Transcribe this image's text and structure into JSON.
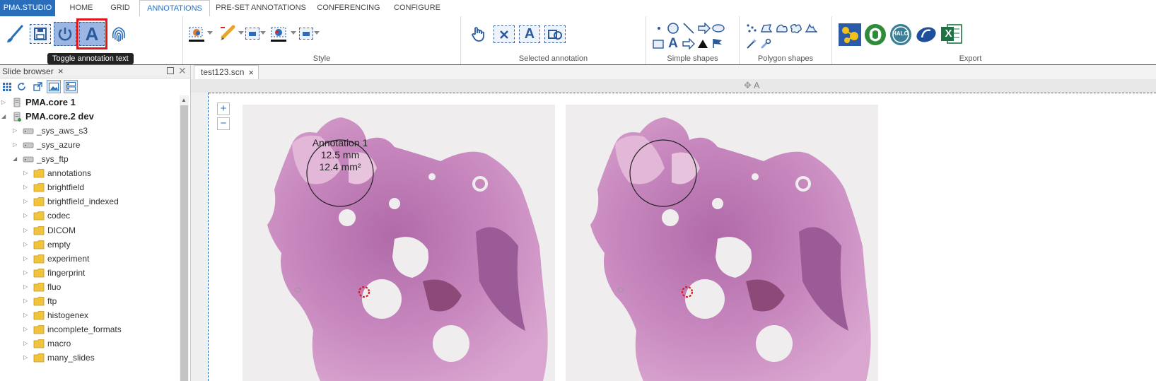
{
  "tabs": [
    {
      "label": "PMA.STUDIO",
      "kind": "brand"
    },
    {
      "label": "HOME",
      "kind": "normal"
    },
    {
      "label": "GRID",
      "kind": "normal"
    },
    {
      "label": "ANNOTATIONS",
      "kind": "active"
    },
    {
      "label": "PRE-SET ANNOTATIONS",
      "kind": "normal"
    },
    {
      "label": "CONFERENCING",
      "kind": "normal"
    },
    {
      "label": "CONFIGURE",
      "kind": "normal"
    }
  ],
  "ribbon": {
    "groups": {
      "style": "Style",
      "selected": "Selected annotation",
      "simple": "Simple shapes",
      "polygon": "Polygon shapes",
      "export": "Export"
    },
    "text_tool_glyph": "A",
    "tooltip": "Toggle annotation text",
    "highlighted_tool": "toggle-annotation-text",
    "export_labels": {
      "halo": "HALO",
      "excel": "X"
    }
  },
  "slide_browser": {
    "title": "Slide browser",
    "close": "×",
    "tree": [
      {
        "label": "PMA.core 1",
        "level": 0,
        "kind": "server",
        "expanded": false
      },
      {
        "label": "PMA.core.2 dev",
        "level": 0,
        "kind": "server-online",
        "expanded": true
      },
      {
        "label": "_sys_aws_s3",
        "level": 1,
        "kind": "drive",
        "expanded": false
      },
      {
        "label": "_sys_azure",
        "level": 1,
        "kind": "drive",
        "expanded": false
      },
      {
        "label": "_sys_ftp",
        "level": 1,
        "kind": "drive",
        "expanded": true
      },
      {
        "label": "annotations",
        "level": 2,
        "kind": "folder",
        "expanded": false
      },
      {
        "label": "brightfield",
        "level": 2,
        "kind": "folder",
        "expanded": false
      },
      {
        "label": "brightfield_indexed",
        "level": 2,
        "kind": "folder",
        "expanded": false
      },
      {
        "label": "codec",
        "level": 2,
        "kind": "folder",
        "expanded": false
      },
      {
        "label": "DICOM",
        "level": 2,
        "kind": "folder",
        "expanded": false
      },
      {
        "label": "empty",
        "level": 2,
        "kind": "folder",
        "expanded": false
      },
      {
        "label": "experiment",
        "level": 2,
        "kind": "folder",
        "expanded": false
      },
      {
        "label": "fingerprint",
        "level": 2,
        "kind": "folder",
        "expanded": false
      },
      {
        "label": "fluo",
        "level": 2,
        "kind": "folder",
        "expanded": false
      },
      {
        "label": "ftp",
        "level": 2,
        "kind": "folder",
        "expanded": false
      },
      {
        "label": "histogenex",
        "level": 2,
        "kind": "folder",
        "expanded": false
      },
      {
        "label": "incomplete_formats",
        "level": 2,
        "kind": "folder",
        "expanded": false
      },
      {
        "label": "macro",
        "level": 2,
        "kind": "folder",
        "expanded": false
      },
      {
        "label": "many_slides",
        "level": 2,
        "kind": "folder",
        "expanded": false
      }
    ]
  },
  "viewer": {
    "tab_label": "test123.scn",
    "tab_close": "×",
    "grid_caption": "A",
    "zoom_in": "+",
    "zoom_out": "−",
    "annotation": {
      "name": "Annotation 1",
      "length": "12.5 mm",
      "area": "12.4 mm²"
    }
  }
}
